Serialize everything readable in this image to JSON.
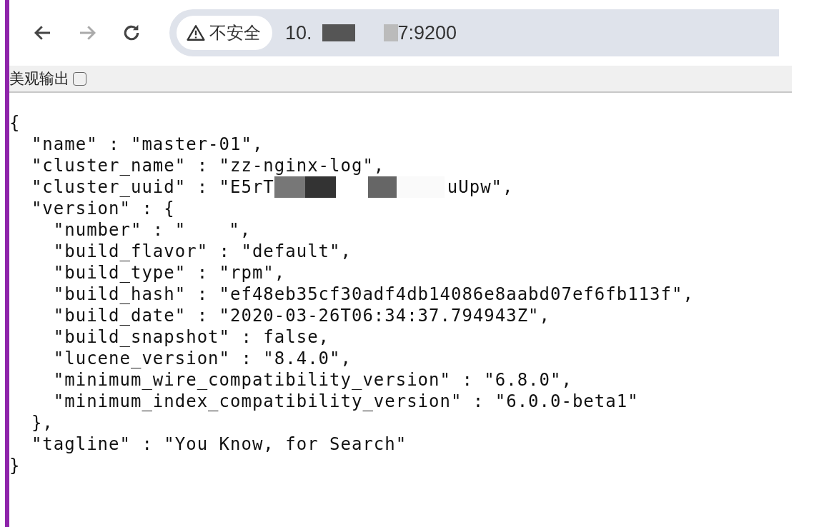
{
  "toolbar": {
    "security_label": "不安全",
    "address": [
      "10.",
      "7:9200"
    ]
  },
  "raw_bar": {
    "label": "美观输出",
    "checked": false
  },
  "json_lines": [
    {
      "parts": [
        "{"
      ]
    },
    {
      "parts": [
        "  \"name\" : \"master-01\","
      ]
    },
    {
      "parts": [
        "  \"cluster_name\" : \"zz-nginx-log\","
      ]
    },
    {
      "parts": [
        "  \"cluster_uuid\" : \"E5rT",
        "uUpw\","
      ]
    },
    {
      "parts": [
        "  \"version\" : {"
      ]
    },
    {
      "parts": [
        "    \"number\" : \"",
        "\","
      ]
    },
    {
      "parts": [
        "    \"build_flavor\" : \"default\","
      ]
    },
    {
      "parts": [
        "    \"build_type\" : \"rpm\","
      ]
    },
    {
      "parts": [
        "    \"build_hash\" : \"ef48eb35cf30adf4db14086e8aabd07ef6fb113f\","
      ]
    },
    {
      "parts": [
        "    \"build_date\" : \"2020-03-26T06:34:37.794943Z\","
      ]
    },
    {
      "parts": [
        "    \"build_snapshot\" : false,"
      ]
    },
    {
      "parts": [
        "    \"lucene_version\" : \"8.4.0\","
      ]
    },
    {
      "parts": [
        "    \"minimum_wire_compatibility_version\" : \"6.8.0\","
      ]
    },
    {
      "parts": [
        "    \"minimum_index_compatibility_version\" : \"6.0.0-beta1\""
      ]
    },
    {
      "parts": [
        "  },"
      ]
    },
    {
      "parts": [
        "  \"tagline\" : \"You Know, for Search\""
      ]
    },
    {
      "parts": [
        "}"
      ]
    }
  ]
}
